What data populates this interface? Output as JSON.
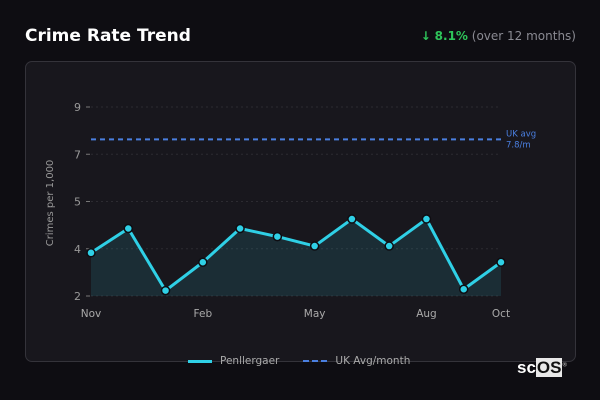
{
  "header": {
    "title": "Crime Rate Trend",
    "change_arrow": "↓",
    "change_pct": "8.1%",
    "change_note": "(over 12 months)"
  },
  "colors": {
    "series": "#2fd0e6",
    "average": "#4a7fe0",
    "positive_change": "#2ec45a"
  },
  "chart_data": {
    "type": "area",
    "ylabel": "Crimes per 1,000",
    "ylim": [
      2,
      9
    ],
    "y_tick_labels": [
      "2",
      "4",
      "5",
      "7",
      "9"
    ],
    "grid": true,
    "x": [
      "Nov",
      "Dec",
      "Jan",
      "Feb",
      "Mar",
      "Apr",
      "May",
      "Jun",
      "Jul",
      "Aug",
      "Sep",
      "Oct"
    ],
    "x_tick_labels": [
      {
        "index": 0,
        "label": "Nov"
      },
      {
        "index": 3,
        "label": "Feb"
      },
      {
        "index": 6,
        "label": "May"
      },
      {
        "index": 9,
        "label": "Aug"
      },
      {
        "index": 11,
        "label": "Oct"
      }
    ],
    "series": [
      {
        "name": "Penllergaer",
        "values": [
          3.6,
          4.5,
          2.2,
          3.25,
          4.5,
          4.2,
          3.85,
          4.85,
          3.85,
          4.85,
          2.25,
          3.25
        ]
      }
    ],
    "reference_line": {
      "name": "UK Avg/month",
      "value": 7.8,
      "annotation_line1": "UK avg",
      "annotation_line2": "7.8/m"
    },
    "legend_position": "bottom"
  },
  "logo": {
    "text_a": "sc",
    "text_b": "OS",
    "mark": "®"
  }
}
